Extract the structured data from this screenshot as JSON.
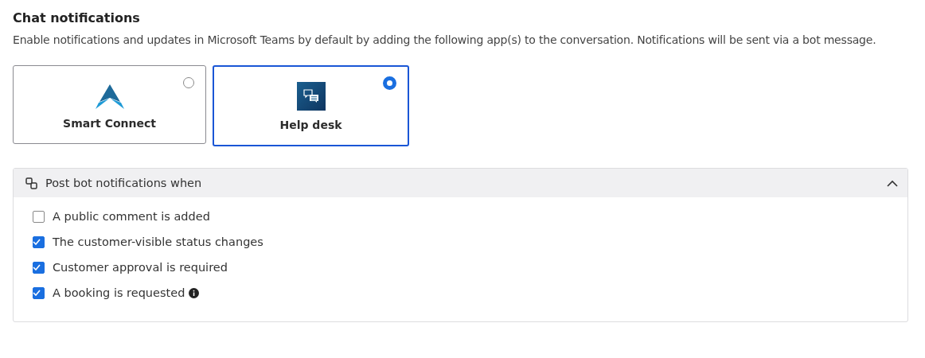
{
  "title": "Chat notifications",
  "description": "Enable notifications and updates in Microsoft Teams by default by adding the following app(s) to the conversation. Notifications will be sent via a bot message.",
  "apps": [
    {
      "label": "Smart Connect",
      "kind": "triangle",
      "selected": false
    },
    {
      "label": "Help desk",
      "kind": "chat",
      "selected": true
    }
  ],
  "section": {
    "title": "Post bot notifications when",
    "expanded": true,
    "options": [
      {
        "label": "A public comment is added",
        "checked": false,
        "info": false
      },
      {
        "label": "The customer-visible status changes",
        "checked": true,
        "info": false
      },
      {
        "label": "Customer approval is required",
        "checked": true,
        "info": false
      },
      {
        "label": "A booking is requested",
        "checked": true,
        "info": true
      }
    ]
  }
}
